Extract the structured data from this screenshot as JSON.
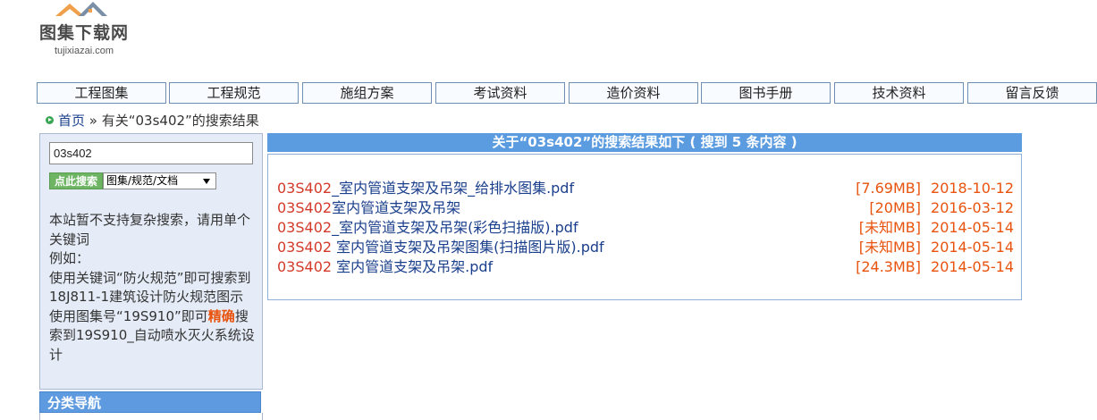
{
  "logo": {
    "title": "图集下载网",
    "domain": "tujixiazai.com",
    "colors": {
      "roof_left": "#f0a04b",
      "roof_right": "#7a8ea6"
    }
  },
  "nav": {
    "items": [
      {
        "label": "工程图集"
      },
      {
        "label": "工程规范"
      },
      {
        "label": "施组方案"
      },
      {
        "label": "考试资料"
      },
      {
        "label": "造价资料"
      },
      {
        "label": "图书手册"
      },
      {
        "label": "技术资料"
      },
      {
        "label": "留言反馈"
      }
    ]
  },
  "breadcrumb": {
    "home": "首页",
    "separator": " » ",
    "current": "有关“03s402”的搜索结果"
  },
  "sidebar": {
    "search_value": "03s402",
    "search_button": "点此搜索",
    "select_value": "图集/规范/文档",
    "help": {
      "line1": "本站暂不支持复杂搜索，请用单个关键词",
      "line2": "例如：",
      "line3": "使用关键词“防火规范”即可搜索到18J811-1建筑设计防火规范图示",
      "line4_a": "使用图集号“19S910”即可",
      "line4_hl": "精确",
      "line4_b": "搜索到19S910_自动喷水灭火系统设计"
    },
    "category_nav": "分类导航"
  },
  "results": {
    "header": "关于“03s402”的搜索结果如下 ( 搜到 5 条内容 )",
    "items": [
      {
        "code": "03S402",
        "rest": "_室内管道支架及吊架_给排水图集.pdf",
        "size": "[7.69MB]",
        "date": "2018-10-12"
      },
      {
        "code": "03S402",
        "rest": "室内管道支架及吊架",
        "size": "[20MB]",
        "date": "2016-03-12"
      },
      {
        "code": "03S402",
        "rest": "_室内管道支架及吊架(彩色扫描版).pdf",
        "size": "[未知MB]",
        "date": "2014-05-14"
      },
      {
        "code": "03S402",
        "rest": " 室内管道支架及吊架图集(扫描图片版).pdf",
        "size": "[未知MB]",
        "date": "2014-05-14"
      },
      {
        "code": "03S402",
        "rest": " 室内管道支架及吊架.pdf",
        "size": "[24.3MB]",
        "date": "2014-05-14"
      }
    ]
  }
}
